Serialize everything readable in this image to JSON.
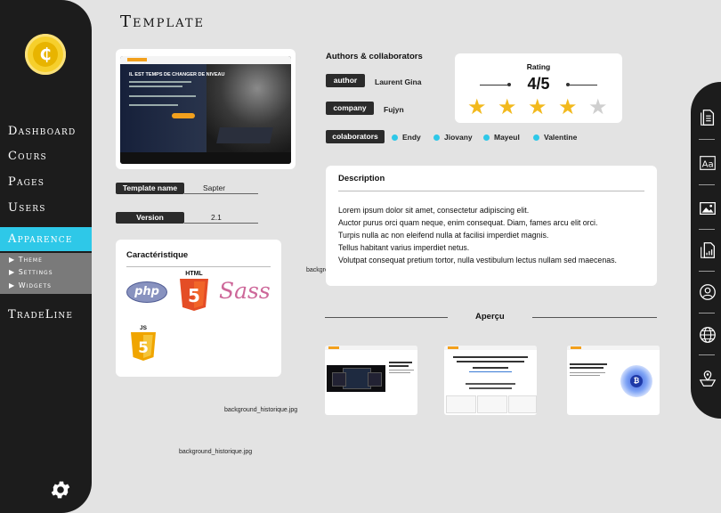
{
  "sidebar": {
    "logo_icon": "coin-c-icon",
    "logo_letter": "₵",
    "nav": [
      "Dashboard",
      "Cours",
      "Pages",
      "Users",
      "Apparence",
      "TradeLine"
    ],
    "active": "Apparence",
    "subnav": [
      "Theme",
      "Settings",
      "Widgets"
    ],
    "settings_icon": "gear-icon"
  },
  "page": {
    "title": "Template"
  },
  "template": {
    "preview_headline": "IL EST TEMPS DE CHANGER DE NIVEAU",
    "name_label": "Template name",
    "name_value": "Sapter",
    "version_label": "Version",
    "version_value": "2.1"
  },
  "caracteristique": {
    "title": "Caractéristique",
    "logos": [
      "php",
      "HTML",
      "Sass",
      "JS"
    ]
  },
  "filenames": [
    "background_historique.jpg",
    "background_historique.jpg",
    "background_historique.jpg"
  ],
  "authors": {
    "title": "Authors & collaborators",
    "author_label": "author",
    "author_value": "Laurent Gina",
    "company_label": "company",
    "company_value": "Fujyn",
    "collaborators_label": "colaborators",
    "collaborators": [
      "Endy",
      "Jiovany",
      "Mayeul",
      "Valentine"
    ]
  },
  "rating": {
    "label": "Rating",
    "value": "4/5",
    "score": 4,
    "max": 5,
    "star_color": "#f2b91d",
    "empty_star_color": "#cfcfcf"
  },
  "description": {
    "title": "Description",
    "lines": [
      "Lorem ipsum dolor sit amet, consectetur adipiscing elit.",
      "Auctor purus orci quam neque, enim consequat. Diam, fames arcu elit orci.",
      "Turpis nulla ac non eleifend nulla at facilisi imperdiet magnis.",
      "Tellus habitant varius imperdiet netus.",
      "Volutpat consequat pretium tortor, nulla vestibulum lectus nullam sed maecenas."
    ]
  },
  "apercu": {
    "title": "Aperçu"
  },
  "colors": {
    "accent": "#2ec8e8",
    "sidebar": "#1c1c1c",
    "background": "#e3e3e3"
  },
  "toolbar": [
    "document-icon",
    "font-icon",
    "image-icon",
    "chart-document-icon",
    "user-circle-icon",
    "globe-icon",
    "map-icon"
  ]
}
